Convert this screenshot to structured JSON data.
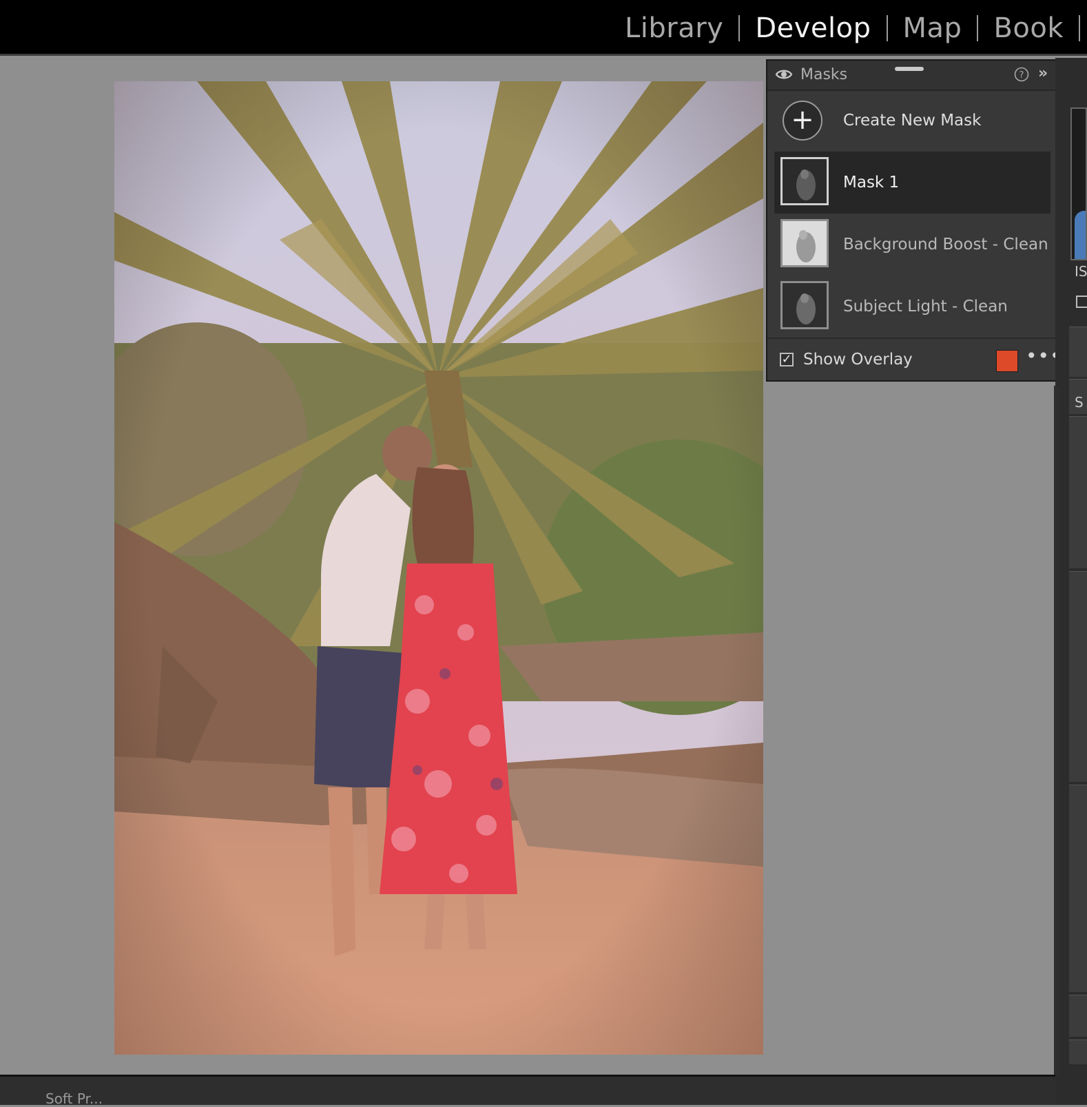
{
  "modules": {
    "library": "Library",
    "develop": "Develop",
    "map": "Map",
    "book": "Book"
  },
  "masks_panel": {
    "title": "Masks",
    "create_label": "Create New Mask",
    "create_icon": "+",
    "masks": [
      {
        "label": "Mask 1",
        "selected": true
      },
      {
        "label": "Background Boost - Clean",
        "selected": false
      },
      {
        "label": "Subject Light - Clean",
        "selected": false
      }
    ],
    "show_overlay_label": "Show Overlay",
    "show_overlay_checked": true,
    "overlay_color": "#dd4a2a",
    "more_glyph": "•••"
  },
  "icons": [
    "eye-icon",
    "help-icon",
    "collapse-chevrons-icon",
    "plus-icon",
    "checkmark-icon",
    "more-options-icon"
  ],
  "bottom_toolbar": {
    "text": "Soft Pr..."
  },
  "right_panel": {
    "label_is": "IS",
    "label_s": "S"
  }
}
